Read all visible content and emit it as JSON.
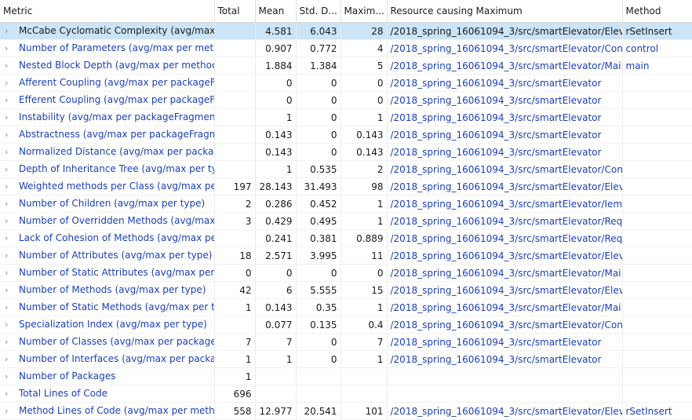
{
  "columns": [
    "Metric",
    "Total",
    "Mean",
    "Std. D...",
    "Maxim...",
    "Resource causing Maximum",
    "Method"
  ],
  "icons": {
    "expand": "chevron-right-icon",
    "glyph": "›"
  },
  "rows": [
    {
      "metric": "McCabe Cyclomatic Complexity (avg/max",
      "total": "",
      "mean": "4.581",
      "std": "6.043",
      "max": "28",
      "resource": "/2018_spring_16061094_3/src/smartElevator/Elev...",
      "method": "rSetInsert",
      "selected": true
    },
    {
      "metric": "Number of Parameters (avg/max per meth",
      "total": "",
      "mean": "0.907",
      "std": "0.772",
      "max": "4",
      "resource": "/2018_spring_16061094_3/src/smartElevator/Con...",
      "method": "control"
    },
    {
      "metric": "Nested Block Depth (avg/max per methoc",
      "total": "",
      "mean": "1.884",
      "std": "1.384",
      "max": "5",
      "resource": "/2018_spring_16061094_3/src/smartElevator/Mai...",
      "method": "main"
    },
    {
      "metric": "Afferent Coupling (avg/max per packageF",
      "total": "",
      "mean": "0",
      "std": "0",
      "max": "0",
      "resource": "/2018_spring_16061094_3/src/smartElevator",
      "method": ""
    },
    {
      "metric": "Efferent Coupling (avg/max per packageFi",
      "total": "",
      "mean": "0",
      "std": "0",
      "max": "0",
      "resource": "/2018_spring_16061094_3/src/smartElevator",
      "method": ""
    },
    {
      "metric": "Instability (avg/max per packageFragment",
      "total": "",
      "mean": "1",
      "std": "0",
      "max": "1",
      "resource": "/2018_spring_16061094_3/src/smartElevator",
      "method": ""
    },
    {
      "metric": "Abstractness (avg/max per packageFragm",
      "total": "",
      "mean": "0.143",
      "std": "0",
      "max": "0.143",
      "resource": "/2018_spring_16061094_3/src/smartElevator",
      "method": ""
    },
    {
      "metric": "Normalized Distance (avg/max per packag",
      "total": "",
      "mean": "0.143",
      "std": "0",
      "max": "0.143",
      "resource": "/2018_spring_16061094_3/src/smartElevator",
      "method": ""
    },
    {
      "metric": "Depth of Inheritance Tree (avg/max per ty",
      "total": "",
      "mean": "1",
      "std": "0.535",
      "max": "2",
      "resource": "/2018_spring_16061094_3/src/smartElevator/Con...",
      "method": ""
    },
    {
      "metric": "Weighted methods per Class (avg/max pe",
      "total": "197",
      "mean": "28.143",
      "std": "31.493",
      "max": "98",
      "resource": "/2018_spring_16061094_3/src/smartElevator/Elev...",
      "method": ""
    },
    {
      "metric": "Number of Children (avg/max per type)",
      "total": "2",
      "mean": "0.286",
      "std": "0.452",
      "max": "1",
      "resource": "/2018_spring_16061094_3/src/smartElevator/Iem...",
      "method": ""
    },
    {
      "metric": "Number of Overridden Methods (avg/max",
      "total": "3",
      "mean": "0.429",
      "std": "0.495",
      "max": "1",
      "resource": "/2018_spring_16061094_3/src/smartElevator/Req...",
      "method": ""
    },
    {
      "metric": "Lack of Cohesion of Methods (avg/max pe",
      "total": "",
      "mean": "0.241",
      "std": "0.381",
      "max": "0.889",
      "resource": "/2018_spring_16061094_3/src/smartElevator/Req...",
      "method": ""
    },
    {
      "metric": "Number of Attributes (avg/max per type)",
      "total": "18",
      "mean": "2.571",
      "std": "3.995",
      "max": "11",
      "resource": "/2018_spring_16061094_3/src/smartElevator/Elev...",
      "method": ""
    },
    {
      "metric": "Number of Static Attributes (avg/max per",
      "total": "0",
      "mean": "0",
      "std": "0",
      "max": "0",
      "resource": "/2018_spring_16061094_3/src/smartElevator/Mai...",
      "method": ""
    },
    {
      "metric": "Number of Methods (avg/max per type)",
      "total": "42",
      "mean": "6",
      "std": "5.555",
      "max": "15",
      "resource": "/2018_spring_16061094_3/src/smartElevator/Elev...",
      "method": ""
    },
    {
      "metric": "Number of Static Methods (avg/max per t",
      "total": "1",
      "mean": "0.143",
      "std": "0.35",
      "max": "1",
      "resource": "/2018_spring_16061094_3/src/smartElevator/Mai...",
      "method": ""
    },
    {
      "metric": "Specialization Index (avg/max per type)",
      "total": "",
      "mean": "0.077",
      "std": "0.135",
      "max": "0.4",
      "resource": "/2018_spring_16061094_3/src/smartElevator/Con...",
      "method": ""
    },
    {
      "metric": "Number of Classes (avg/max per package",
      "total": "7",
      "mean": "7",
      "std": "0",
      "max": "7",
      "resource": "/2018_spring_16061094_3/src/smartElevator",
      "method": ""
    },
    {
      "metric": "Number of Interfaces (avg/max per packa",
      "total": "1",
      "mean": "1",
      "std": "0",
      "max": "1",
      "resource": "/2018_spring_16061094_3/src/smartElevator",
      "method": ""
    },
    {
      "metric": "Number of Packages",
      "total": "1",
      "mean": "",
      "std": "",
      "max": "",
      "resource": "",
      "method": ""
    },
    {
      "metric": "Total Lines of Code",
      "total": "696",
      "mean": "",
      "std": "",
      "max": "",
      "resource": "",
      "method": ""
    },
    {
      "metric": "Method Lines of Code (avg/max per meth",
      "total": "558",
      "mean": "12.977",
      "std": "20.541",
      "max": "101",
      "resource": "/2018_spring_16061094_3/src/smartElevator/Elev...",
      "method": "rSetInsert"
    }
  ]
}
